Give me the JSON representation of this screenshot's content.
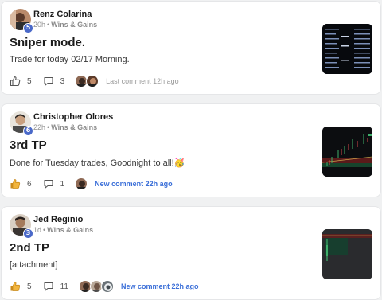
{
  "posts": [
    {
      "author": "Renz Colarina",
      "level": "5",
      "time": "20h",
      "space": "Wins & Gains",
      "title": "Sniper mode.",
      "excerpt": "Trade for today 02/17 Morning.",
      "likes": "5",
      "comments": "3",
      "comment_note": "Last comment 12h ago",
      "comment_note_style": "last",
      "liked": false
    },
    {
      "author": "Christopher Olores",
      "level": "6",
      "time": "22h",
      "space": "Wins & Gains",
      "title": "3rd TP",
      "excerpt": "Done for Tuesday trades, Goodnight to all!🥳",
      "likes": "6",
      "comments": "1",
      "comment_note": "New comment 22h ago",
      "comment_note_style": "new",
      "liked": true
    },
    {
      "author": "Jed Reginio",
      "level": "3",
      "time": "1d",
      "space": "Wins & Gains",
      "title": "2nd TP",
      "excerpt": "[attachment]",
      "likes": "5",
      "comments": "11",
      "comment_note": "New comment 22h ago",
      "comment_note_style": "new",
      "liked": true
    }
  ],
  "separator": "•",
  "colors": {
    "level_badge": "#4a69c9",
    "new_comment": "#3b6fd8",
    "liked_thumb": "#f2b53d",
    "background": "#f0f1f2"
  },
  "icons": {
    "like": "thumbs-up-icon",
    "comment": "speech-bubble-icon"
  }
}
